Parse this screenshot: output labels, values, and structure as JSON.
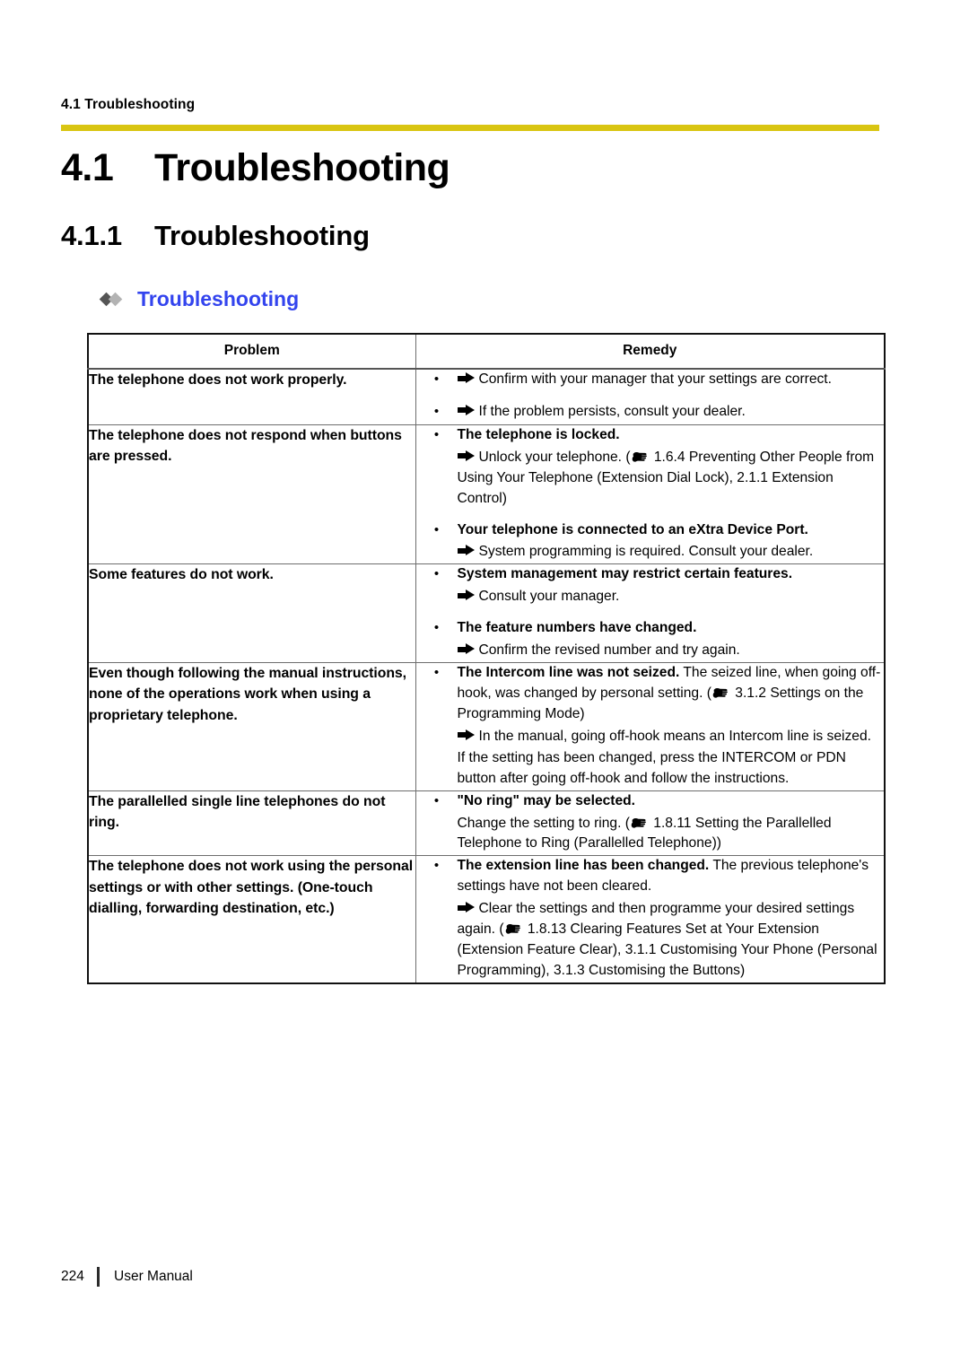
{
  "running_header": "4.1 Troubleshooting",
  "colors": {
    "rule": "#d9c512",
    "section_heading": "#3344ee"
  },
  "headings": {
    "h1_number": "4.1",
    "h1_title": "Troubleshooting",
    "h2_number": "4.1.1",
    "h2_title": "Troubleshooting",
    "h3_title": "Troubleshooting"
  },
  "table": {
    "columns": [
      "Problem",
      "Remedy"
    ],
    "rows": [
      {
        "problem": "The telephone does not work properly.",
        "remedy": [
          {
            "kind": "bullet-arrow",
            "text": "Confirm with your manager that your settings are correct."
          },
          {
            "kind": "bullet-arrow",
            "text": "If the problem persists, consult your dealer."
          }
        ]
      },
      {
        "problem": "The telephone does not respond when buttons are pressed.",
        "remedy": [
          {
            "kind": "bullet-bold",
            "text": "The telephone is locked."
          },
          {
            "kind": "arrow-ref",
            "before": "Unlock your telephone. (",
            "after": "1.6.4 Preventing Other People from Using Your Telephone (Extension Dial Lock), 2.1.1 Extension Control)"
          },
          {
            "kind": "bullet-bold",
            "text": "Your telephone is connected to an eXtra Device Port."
          },
          {
            "kind": "arrow",
            "text": "System programming is required. Consult your dealer."
          }
        ]
      },
      {
        "problem": "Some features do not work.",
        "remedy": [
          {
            "kind": "bullet-bold",
            "text": "System management may restrict certain features."
          },
          {
            "kind": "arrow",
            "text": "Consult your manager."
          },
          {
            "kind": "bullet-bold",
            "text": "The feature numbers have changed."
          },
          {
            "kind": "arrow",
            "text": "Confirm the revised number and try again."
          }
        ]
      },
      {
        "problem": "Even though following the manual instructions, none of the operations work when using a proprietary telephone.",
        "remedy": [
          {
            "kind": "bullet-bold-run-ref",
            "lead": "The Intercom line was not seized.",
            "before": " The seized line, when going off-hook, was changed by personal setting. (",
            "after": "3.1.2 Settings on the Programming Mode)"
          },
          {
            "kind": "arrow",
            "text": "In the manual, going off-hook means an Intercom line is seized."
          },
          {
            "kind": "plain",
            "text": "If the setting has been changed, press the INTERCOM or PDN button after going off-hook and follow the instructions."
          }
        ]
      },
      {
        "problem": "The parallelled single line telephones do not ring.",
        "remedy": [
          {
            "kind": "bullet-bold",
            "text": "\"No ring\" may be selected."
          },
          {
            "kind": "plain-ref",
            "before": "Change the setting to ring. (",
            "after": "1.8.11 Setting the Parallelled Telephone to Ring (Parallelled Telephone))"
          }
        ]
      },
      {
        "problem": "The telephone does not work using the personal settings or with other settings. (One-touch dialling, forwarding destination, etc.)",
        "remedy": [
          {
            "kind": "bullet-bold-run",
            "lead": "The extension line has been changed.",
            "text": " The previous telephone's settings have not been cleared."
          },
          {
            "kind": "arrow-ref",
            "before": "Clear the settings and then programme your desired settings again. (",
            "after": "1.8.13 Clearing Features Set at Your Extension (Extension Feature Clear), 3.1.1 Customising Your Phone (Personal Programming), 3.1.3 Customising the Buttons)"
          }
        ]
      }
    ]
  },
  "footer": {
    "page_number": "224",
    "label": "User Manual"
  }
}
